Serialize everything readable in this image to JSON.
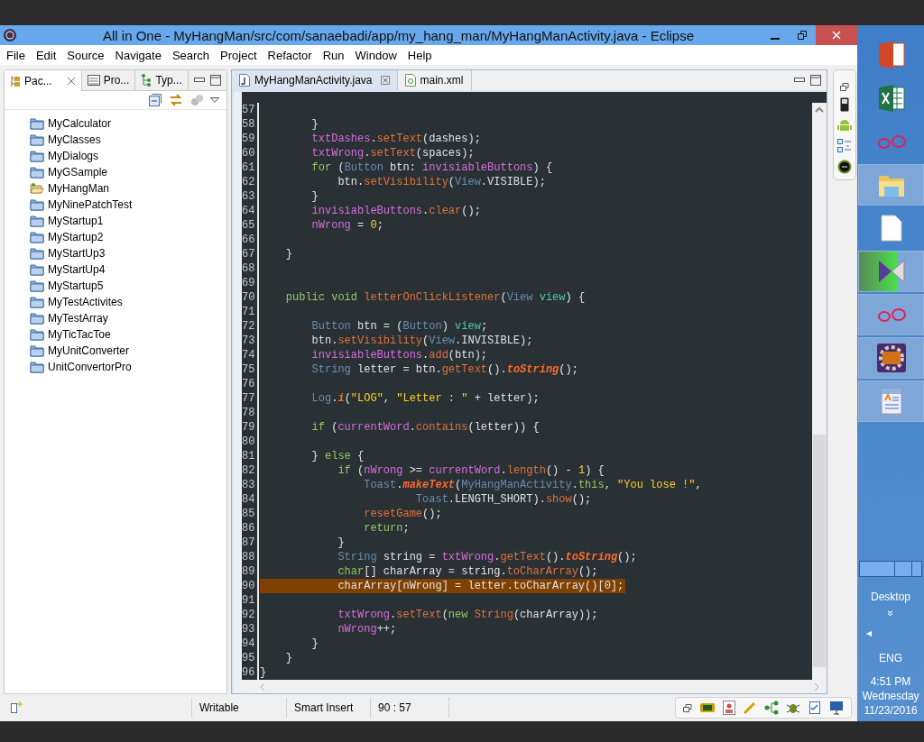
{
  "window": {
    "title": "All in One - MyHangMan/src/com/sanaebadi/app/my_hang_man/MyHangManActivity.java - Eclipse"
  },
  "menu": [
    "File",
    "Edit",
    "Source",
    "Navigate",
    "Search",
    "Project",
    "Refactor",
    "Run",
    "Window",
    "Help"
  ],
  "left_panel": {
    "tabs": [
      {
        "label": "Pac...",
        "selected": true
      },
      {
        "label": "Pro...",
        "selected": false
      },
      {
        "label": "Typ...",
        "selected": false
      }
    ],
    "projects": [
      {
        "name": "MyCalculator",
        "open": false
      },
      {
        "name": "MyClasses",
        "open": false
      },
      {
        "name": "MyDialogs",
        "open": false
      },
      {
        "name": "MyGSample",
        "open": false
      },
      {
        "name": "MyHangMan",
        "open": true
      },
      {
        "name": "MyNinePatchTest",
        "open": false
      },
      {
        "name": "MyStartup1",
        "open": false
      },
      {
        "name": "MyStartup2",
        "open": false
      },
      {
        "name": "MyStartUp3",
        "open": false
      },
      {
        "name": "MyStartUp4",
        "open": false
      },
      {
        "name": "MyStartup5",
        "open": false
      },
      {
        "name": "MyTestActivites",
        "open": false
      },
      {
        "name": "MyTestArray",
        "open": false
      },
      {
        "name": "MyTicTacToe",
        "open": false
      },
      {
        "name": "MyUnitConverter",
        "open": false
      },
      {
        "name": "UnitConvertorPro",
        "open": false
      }
    ]
  },
  "editor": {
    "tabs": [
      {
        "label": "MyHangManActivity.java",
        "kind": "java",
        "selected": true
      },
      {
        "label": "main.xml",
        "kind": "xml",
        "selected": false
      }
    ],
    "lines": [
      {
        "number": "57",
        "highlighted": false
      },
      {
        "number": "58",
        "highlighted": false,
        "tokens": [
          {
            "kind": "plain",
            "text": "        }"
          }
        ]
      },
      {
        "number": "59",
        "highlighted": false,
        "tokens": [
          {
            "kind": "field",
            "text": "        txtDashes"
          },
          {
            "kind": "plain",
            "text": "."
          },
          {
            "kind": "method",
            "text": "setText"
          },
          {
            "kind": "plain",
            "text": "(dashes);"
          }
        ]
      },
      {
        "number": "60",
        "highlighted": false,
        "tokens": [
          {
            "kind": "field",
            "text": "        txtWrong"
          },
          {
            "kind": "plain",
            "text": "."
          },
          {
            "kind": "method",
            "text": "setText"
          },
          {
            "kind": "plain",
            "text": "(spaces);"
          }
        ]
      },
      {
        "number": "61",
        "highlighted": false,
        "tokens": [
          {
            "kind": "keyword",
            "text": "        for"
          },
          {
            "kind": "plain",
            "text": " ("
          },
          {
            "kind": "type",
            "text": "Button"
          },
          {
            "kind": "plain",
            "text": " btn: "
          },
          {
            "kind": "field",
            "text": "invisiableButtons"
          },
          {
            "kind": "plain",
            "text": ") {"
          }
        ]
      },
      {
        "number": "62",
        "highlighted": false,
        "tokens": [
          {
            "kind": "plain",
            "text": "            btn."
          },
          {
            "kind": "method",
            "text": "setVisibility"
          },
          {
            "kind": "plain",
            "text": "("
          },
          {
            "kind": "type",
            "text": "View"
          },
          {
            "kind": "plain",
            "text": ".VISIBLE);"
          }
        ]
      },
      {
        "number": "63",
        "highlighted": false,
        "tokens": [
          {
            "kind": "plain",
            "text": "        }"
          }
        ]
      },
      {
        "number": "64",
        "highlighted": false,
        "tokens": [
          {
            "kind": "field",
            "text": "        invisiableButtons"
          },
          {
            "kind": "plain",
            "text": "."
          },
          {
            "kind": "method",
            "text": "clear"
          },
          {
            "kind": "plain",
            "text": "();"
          }
        ]
      },
      {
        "number": "65",
        "highlighted": false,
        "tokens": [
          {
            "kind": "field",
            "text": "        nWrong"
          },
          {
            "kind": "plain",
            "text": " = "
          },
          {
            "kind": "number",
            "text": "0"
          },
          {
            "kind": "plain",
            "text": ";"
          }
        ]
      },
      {
        "number": "66",
        "highlighted": false
      },
      {
        "number": "67",
        "highlighted": false,
        "tokens": [
          {
            "kind": "plain",
            "text": "    }"
          }
        ]
      },
      {
        "number": "68",
        "highlighted": false
      },
      {
        "number": "69",
        "highlighted": false
      },
      {
        "number": "70",
        "highlighted": false,
        "tokens": [
          {
            "kind": "keyword",
            "text": "    public void"
          },
          {
            "kind": "method",
            "text": " letterOnClickListener"
          },
          {
            "kind": "plain",
            "text": "("
          },
          {
            "kind": "type",
            "text": "View"
          },
          {
            "kind": "param",
            "text": " view"
          },
          {
            "kind": "plain",
            "text": ") {"
          }
        ]
      },
      {
        "number": "71",
        "highlighted": false
      },
      {
        "number": "72",
        "highlighted": false,
        "tokens": [
          {
            "kind": "type",
            "text": "        Button"
          },
          {
            "kind": "plain",
            "text": " btn = ("
          },
          {
            "kind": "type",
            "text": "Button"
          },
          {
            "kind": "plain",
            "text": ") "
          },
          {
            "kind": "param",
            "text": "view"
          },
          {
            "kind": "plain",
            "text": ";"
          }
        ]
      },
      {
        "number": "73",
        "highlighted": false,
        "tokens": [
          {
            "kind": "plain",
            "text": "        btn."
          },
          {
            "kind": "method",
            "text": "setVisibility"
          },
          {
            "kind": "plain",
            "text": "("
          },
          {
            "kind": "type",
            "text": "View"
          },
          {
            "kind": "plain",
            "text": ".INVISIBLE);"
          }
        ]
      },
      {
        "number": "74",
        "highlighted": false,
        "tokens": [
          {
            "kind": "field",
            "text": "        invisiableButtons"
          },
          {
            "kind": "plain",
            "text": "."
          },
          {
            "kind": "method",
            "text": "add"
          },
          {
            "kind": "plain",
            "text": "(btn);"
          }
        ]
      },
      {
        "number": "75",
        "highlighted": false,
        "tokens": [
          {
            "kind": "type",
            "text": "        String"
          },
          {
            "kind": "plain",
            "text": " letter = btn."
          },
          {
            "kind": "method",
            "text": "getText"
          },
          {
            "kind": "plain",
            "text": "()."
          },
          {
            "kind": "static",
            "text": "toString"
          },
          {
            "kind": "plain",
            "text": "();"
          }
        ]
      },
      {
        "number": "76",
        "highlighted": false
      },
      {
        "number": "77",
        "highlighted": false,
        "tokens": [
          {
            "kind": "type",
            "text": "        Log"
          },
          {
            "kind": "plain",
            "text": "."
          },
          {
            "kind": "static",
            "text": "i"
          },
          {
            "kind": "plain",
            "text": "("
          },
          {
            "kind": "string",
            "text": "\"LOG\""
          },
          {
            "kind": "plain",
            "text": ", "
          },
          {
            "kind": "string",
            "text": "\"Letter : \""
          },
          {
            "kind": "plain",
            "text": " + letter);"
          }
        ]
      },
      {
        "number": "78",
        "highlighted": false
      },
      {
        "number": "79",
        "highlighted": false,
        "tokens": [
          {
            "kind": "keyword",
            "text": "        if"
          },
          {
            "kind": "plain",
            "text": " ("
          },
          {
            "kind": "field",
            "text": "currentWord"
          },
          {
            "kind": "plain",
            "text": "."
          },
          {
            "kind": "method",
            "text": "contains"
          },
          {
            "kind": "plain",
            "text": "(letter)) {"
          }
        ]
      },
      {
        "number": "80",
        "highlighted": false
      },
      {
        "number": "81",
        "highlighted": false,
        "tokens": [
          {
            "kind": "plain",
            "text": "        } "
          },
          {
            "kind": "keyword",
            "text": "else"
          },
          {
            "kind": "plain",
            "text": " {"
          }
        ]
      },
      {
        "number": "82",
        "highlighted": false,
        "tokens": [
          {
            "kind": "keyword",
            "text": "            if"
          },
          {
            "kind": "plain",
            "text": " ("
          },
          {
            "kind": "field",
            "text": "nWrong"
          },
          {
            "kind": "plain",
            "text": " >= "
          },
          {
            "kind": "field",
            "text": "currentWord"
          },
          {
            "kind": "plain",
            "text": "."
          },
          {
            "kind": "method",
            "text": "length"
          },
          {
            "kind": "plain",
            "text": "() - "
          },
          {
            "kind": "number",
            "text": "1"
          },
          {
            "kind": "plain",
            "text": ") {"
          }
        ]
      },
      {
        "number": "83",
        "highlighted": false,
        "tokens": [
          {
            "kind": "type",
            "text": "                Toast"
          },
          {
            "kind": "plain",
            "text": "."
          },
          {
            "kind": "static",
            "text": "makeText"
          },
          {
            "kind": "plain",
            "text": "("
          },
          {
            "kind": "type",
            "text": "MyHangManActivity"
          },
          {
            "kind": "plain",
            "text": "."
          },
          {
            "kind": "keyword",
            "text": "this"
          },
          {
            "kind": "plain",
            "text": ", "
          },
          {
            "kind": "string",
            "text": "\"You lose !\""
          },
          {
            "kind": "plain",
            "text": ","
          }
        ]
      },
      {
        "number": "84",
        "highlighted": false,
        "tokens": [
          {
            "kind": "type",
            "text": "                        Toast"
          },
          {
            "kind": "plain",
            "text": ".LENGTH_SHORT)."
          },
          {
            "kind": "method",
            "text": "show"
          },
          {
            "kind": "plain",
            "text": "();"
          }
        ]
      },
      {
        "number": "85",
        "highlighted": false,
        "tokens": [
          {
            "kind": "method",
            "text": "                resetGame"
          },
          {
            "kind": "plain",
            "text": "();"
          }
        ]
      },
      {
        "number": "86",
        "highlighted": false,
        "tokens": [
          {
            "kind": "keyword",
            "text": "                return"
          },
          {
            "kind": "plain",
            "text": ";"
          }
        ]
      },
      {
        "number": "87",
        "highlighted": false,
        "tokens": [
          {
            "kind": "plain",
            "text": "            }"
          }
        ]
      },
      {
        "number": "88",
        "highlighted": false,
        "tokens": [
          {
            "kind": "type",
            "text": "            String"
          },
          {
            "kind": "plain",
            "text": " string = "
          },
          {
            "kind": "field",
            "text": "txtWrong"
          },
          {
            "kind": "plain",
            "text": "."
          },
          {
            "kind": "method",
            "text": "getText"
          },
          {
            "kind": "plain",
            "text": "()."
          },
          {
            "kind": "static",
            "text": "toString"
          },
          {
            "kind": "plain",
            "text": "();"
          }
        ]
      },
      {
        "number": "89",
        "highlighted": false,
        "tokens": [
          {
            "kind": "keyword",
            "text": "            char"
          },
          {
            "kind": "plain",
            "text": "[] charArray = string."
          },
          {
            "kind": "method",
            "text": "toCharArray"
          },
          {
            "kind": "plain",
            "text": "();"
          }
        ]
      },
      {
        "number": "90",
        "highlighted": true,
        "tokens": [
          {
            "kind": "plain",
            "text": "            charArray[nWrong] = letter.toCharArray()[0];"
          }
        ]
      },
      {
        "number": "91",
        "highlighted": false
      },
      {
        "number": "92",
        "highlighted": false,
        "tokens": [
          {
            "kind": "field",
            "text": "            txtWrong"
          },
          {
            "kind": "plain",
            "text": "."
          },
          {
            "kind": "method",
            "text": "setText"
          },
          {
            "kind": "plain",
            "text": "("
          },
          {
            "kind": "keyword",
            "text": "new"
          },
          {
            "kind": "method",
            "text": " String"
          },
          {
            "kind": "plain",
            "text": "(charArray));"
          }
        ]
      },
      {
        "number": "93",
        "highlighted": false,
        "tokens": [
          {
            "kind": "field",
            "text": "            nWrong"
          },
          {
            "kind": "plain",
            "text": "++;"
          }
        ]
      },
      {
        "number": "94",
        "highlighted": false,
        "tokens": [
          {
            "kind": "plain",
            "text": "        }"
          }
        ]
      },
      {
        "number": "95",
        "highlighted": false,
        "tokens": [
          {
            "kind": "plain",
            "text": "    }"
          }
        ]
      },
      {
        "number": "96",
        "highlighted": false,
        "tokens": [
          {
            "kind": "plain",
            "text": "}"
          }
        ]
      }
    ]
  },
  "status_bar": {
    "mode": "Writable",
    "insert": "Smart Insert",
    "position": "90 : 57"
  },
  "taskbar": {
    "apps": [
      {
        "kind": "slides",
        "running": false
      },
      {
        "kind": "sheet",
        "running": false
      },
      {
        "kind": "circles",
        "running": false
      },
      {
        "kind": "folder",
        "running": true
      },
      {
        "kind": "file",
        "running": false
      },
      {
        "kind": "player",
        "running": true,
        "level": 0.6
      },
      {
        "kind": "circles",
        "running": true
      },
      {
        "kind": "javaee",
        "running": true
      },
      {
        "kind": "doc",
        "running": true
      }
    ],
    "desktop": "Desktop",
    "chevron": "»",
    "arrow": "◂",
    "language": "ENG",
    "time": "4:51 PM",
    "day": "Wednesday",
    "date": "11/23/2016"
  }
}
